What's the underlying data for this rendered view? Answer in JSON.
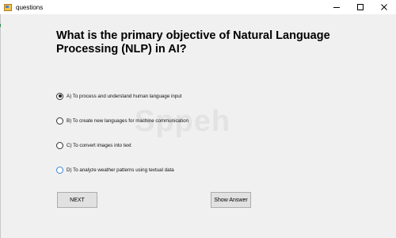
{
  "window": {
    "title": "questions",
    "icon": "app-form-icon"
  },
  "question": {
    "text": "What is the primary objective of Natural Language Processing (NLP) in AI?"
  },
  "options": [
    {
      "label": "A) To process and understand human language input",
      "checked": true
    },
    {
      "label": "B) To create new languages for machine communication",
      "checked": false
    },
    {
      "label": "C) To convert images into text",
      "checked": false
    },
    {
      "label": "D) To analyze weather patterns using textual data",
      "checked": false
    }
  ],
  "buttons": {
    "next": "NEXT",
    "show_answer": "Show Answer"
  },
  "watermark": {
    "text": "Sppeh"
  }
}
